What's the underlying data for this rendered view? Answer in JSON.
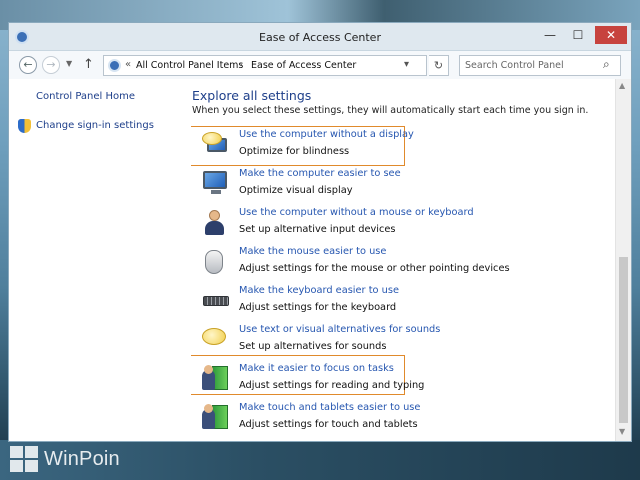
{
  "window": {
    "title": "Ease of Access Center",
    "controls": {
      "minimize": "—",
      "maximize": "☐",
      "close": "✕"
    }
  },
  "nav": {
    "back": "←",
    "forward": "→",
    "up": "↑",
    "breadcrumb": [
      "All Control Panel Items",
      "Ease of Access Center"
    ],
    "search_placeholder": "Search Control Panel"
  },
  "sidebar": {
    "items": [
      {
        "label": "Control Panel Home"
      },
      {
        "label": "Change sign-in settings"
      }
    ]
  },
  "main": {
    "heading": "Explore all settings",
    "subtext": "When you select these settings, they will automatically start each time you sign in.",
    "items": [
      {
        "link": "Use the computer without a display",
        "desc": "Optimize for blindness",
        "icon": "speech-monitor-icon",
        "highlighted": true
      },
      {
        "link": "Make the computer easier to see",
        "desc": "Optimize visual display",
        "icon": "monitor-icon",
        "highlighted": false
      },
      {
        "link": "Use the computer without a mouse or keyboard",
        "desc": "Set up alternative input devices",
        "icon": "person-icon",
        "highlighted": false
      },
      {
        "link": "Make the mouse easier to use",
        "desc": "Adjust settings for the mouse or other pointing devices",
        "icon": "mouse-icon",
        "highlighted": false
      },
      {
        "link": "Make the keyboard easier to use",
        "desc": "Adjust settings for the keyboard",
        "icon": "keyboard-icon",
        "highlighted": false
      },
      {
        "link": "Use text or visual alternatives for sounds",
        "desc": "Set up alternatives for sounds",
        "icon": "speech-bubble-icon",
        "highlighted": false
      },
      {
        "link": "Make it easier to focus on tasks",
        "desc": "Adjust settings for reading and typing",
        "icon": "focus-icon",
        "highlighted": true
      },
      {
        "link": "Make touch and tablets easier to use",
        "desc": "Adjust settings for touch and tablets",
        "icon": "tablet-icon",
        "highlighted": false
      }
    ]
  },
  "watermark": {
    "text": "WinPoin"
  },
  "colors": {
    "link": "#2757b0",
    "heading": "#1e3f8a",
    "highlight": "#e08a2c"
  }
}
